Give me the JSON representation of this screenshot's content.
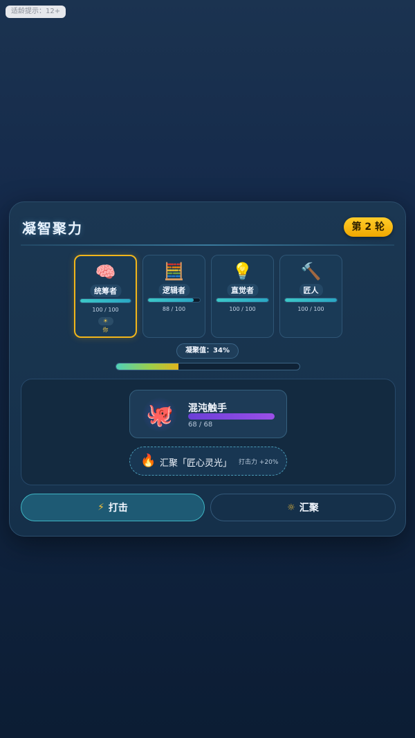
{
  "age_tip": "适龄提示：12+",
  "panel": {
    "title": "凝智聚力",
    "round_label": "第 2 轮"
  },
  "characters": [
    {
      "name": "统筹者",
      "icon": "brain-icon",
      "emoji": "🧠",
      "hp": 100,
      "max_hp": 100,
      "hp_text": "100 / 100",
      "selected": true,
      "you_icon": "☀",
      "you_label": "你"
    },
    {
      "name": "逻辑者",
      "icon": "abacus-icon",
      "emoji": "🧮",
      "hp": 88,
      "max_hp": 100,
      "hp_text": "88 / 100",
      "selected": false
    },
    {
      "name": "直觉者",
      "icon": "lightbulb-icon",
      "emoji": "💡",
      "hp": 100,
      "max_hp": 100,
      "hp_text": "100 / 100",
      "selected": false
    },
    {
      "name": "匠人",
      "icon": "hammer-icon",
      "emoji": "🔨",
      "hp": 100,
      "max_hp": 100,
      "hp_text": "100 / 100",
      "selected": false
    }
  ],
  "focus": {
    "label": "凝聚值：34%",
    "percent": 34
  },
  "enemy": {
    "name": "混沌触手",
    "icon": "octopus-icon",
    "emoji": "🐙",
    "hp": 68,
    "max_hp": 68,
    "hp_text": "68 / 68"
  },
  "gather_status": {
    "icon": "fire-icon",
    "emoji": "🔥",
    "text": "汇聚「匠心灵光」",
    "bonus": "打击力 +20%"
  },
  "actions": {
    "strike": {
      "label": "打击",
      "icon": "lightning-icon",
      "glyph": "⚡"
    },
    "gather": {
      "label": "汇聚",
      "icon": "sun-icon",
      "glyph": "☼"
    }
  },
  "colors": {
    "accent_gold": "#f2b61a",
    "hp_teal": "#3cc7c7",
    "enemy_hp_purple": "#7b45e0"
  }
}
